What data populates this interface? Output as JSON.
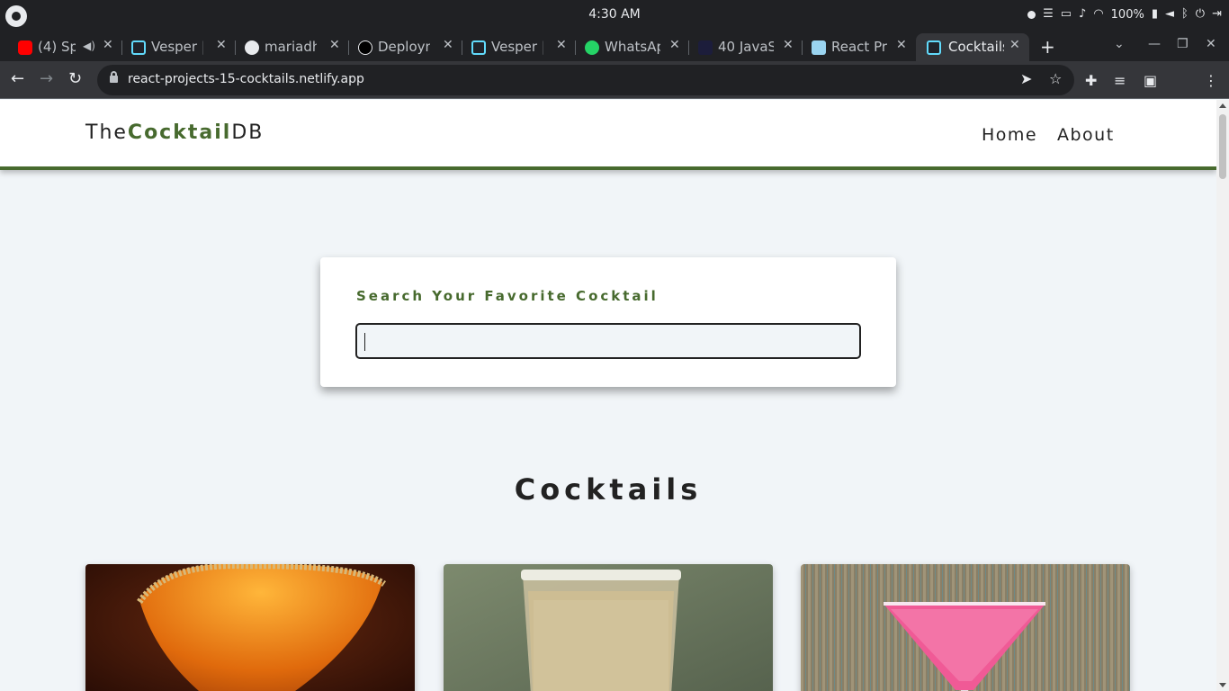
{
  "os": {
    "clock": "4:30 AM",
    "battery": "100%"
  },
  "tabs": [
    {
      "title": "(4) Sp",
      "favicon": "youtube-icon",
      "active": false
    },
    {
      "title": "Vesper |",
      "favicon": "react-icon",
      "active": false
    },
    {
      "title": "mariadh",
      "favicon": "github-icon",
      "active": false
    },
    {
      "title": "Deploym",
      "favicon": "vercel-icon",
      "active": false
    },
    {
      "title": "Vesper |",
      "favicon": "react-icon",
      "active": false
    },
    {
      "title": "WhatsAp",
      "favicon": "whatsapp-icon",
      "active": false
    },
    {
      "title": "40 JavaS",
      "favicon": "udemy-icon",
      "active": false
    },
    {
      "title": "React Pro",
      "favicon": "replit-icon",
      "active": false
    },
    {
      "title": "Cocktails",
      "favicon": "react-icon",
      "active": true
    }
  ],
  "address_bar": {
    "url": "react-projects-15-cocktails.netlify.app"
  },
  "site": {
    "logo": {
      "prefix": "The",
      "highlight": "Cocktail",
      "suffix": "DB"
    },
    "nav": {
      "home": "Home",
      "about": "About"
    },
    "search": {
      "label": "Search Your Favorite Cocktail",
      "value": ""
    },
    "section_title": "Cocktails"
  },
  "colors": {
    "brand_green": "#476a2e",
    "page_bg": "#f1f5f8"
  }
}
